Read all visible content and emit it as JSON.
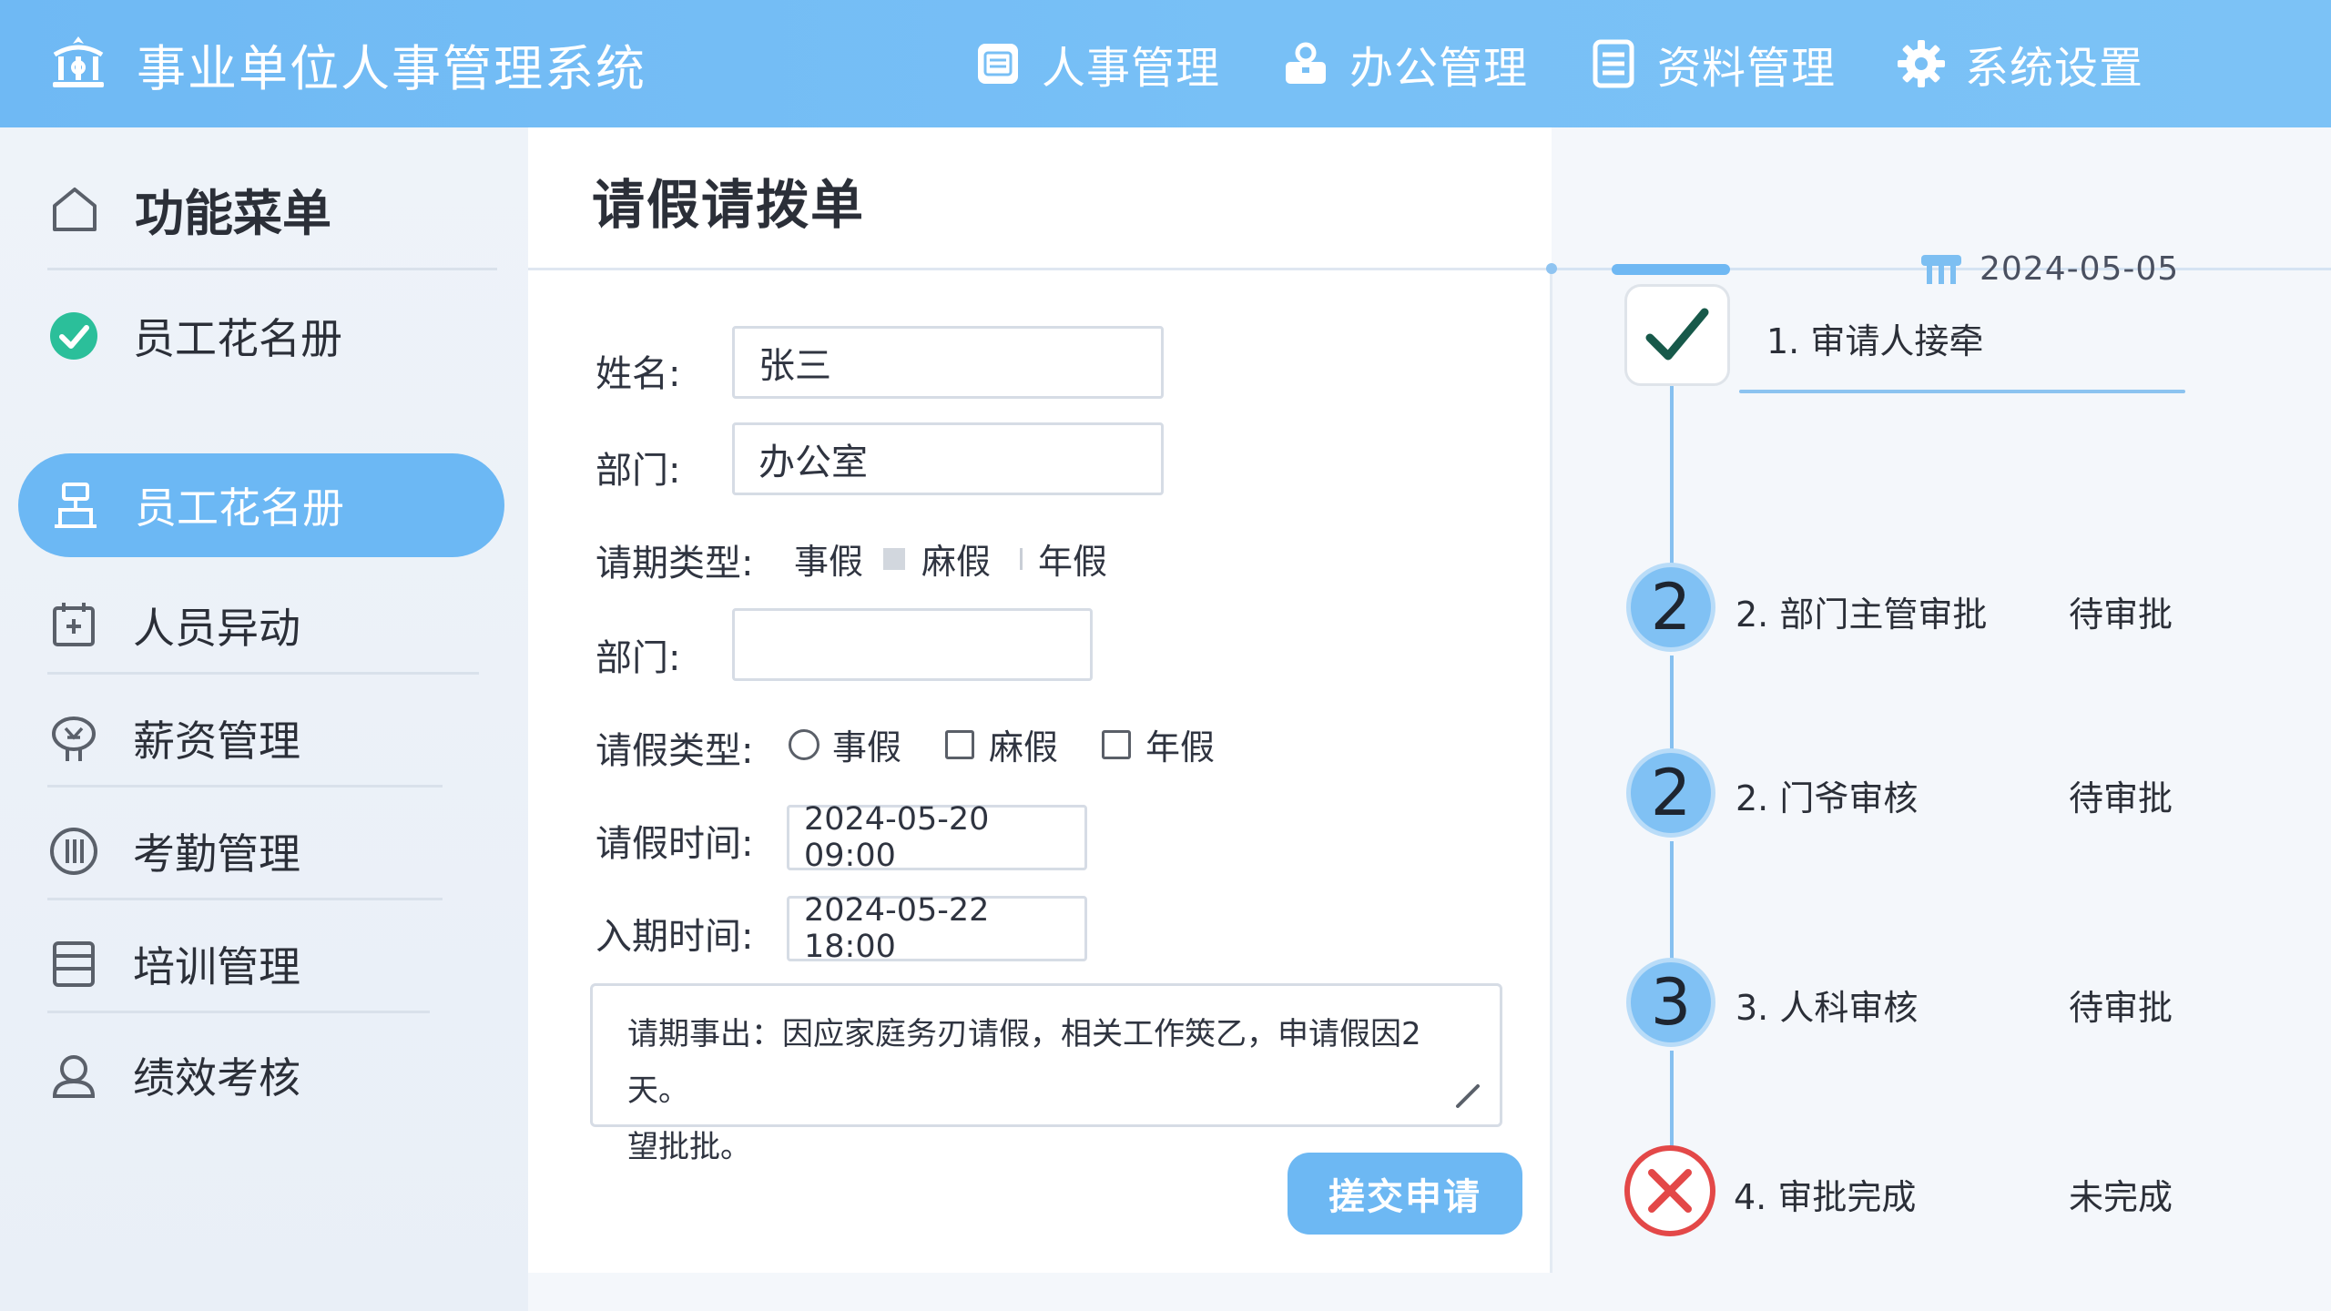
{
  "app": {
    "title": "事业单位人事管理系统"
  },
  "topnav": [
    {
      "label": "人事管理",
      "icon": "id-card-icon"
    },
    {
      "label": "办公管理",
      "icon": "briefcase-icon"
    },
    {
      "label": "资料管理",
      "icon": "document-icon"
    },
    {
      "label": "系统设置",
      "icon": "gear-icon"
    }
  ],
  "sidebar": {
    "header": "功能菜单",
    "items": [
      {
        "label": "员工花名册",
        "icon": "check-circle-icon"
      },
      {
        "label": "员工花名册",
        "icon": "org-chart-icon",
        "active": true
      },
      {
        "label": "人员异动",
        "icon": "calendar-icon"
      },
      {
        "label": "薪资管理",
        "icon": "money-icon"
      },
      {
        "label": "考勤管理",
        "icon": "clock-icon"
      },
      {
        "label": "培训管理",
        "icon": "book-icon"
      },
      {
        "label": "绩效考核",
        "icon": "user-icon"
      }
    ]
  },
  "form": {
    "title": "请假请拨单",
    "name_label": "姓名:",
    "name_value": "张三",
    "dept_label": "部门:",
    "dept_value": "办公室",
    "period_type_label": "请期类型:",
    "period_type_options": [
      "事假",
      "麻假",
      "年假"
    ],
    "dept2_label": "部门:",
    "dept2_value": "",
    "leave_type_label": "请假类型:",
    "leave_type_options": [
      "事假",
      "麻假",
      "年假"
    ],
    "start_label": "请假时间:",
    "start_value": "2024-05-20 09:00",
    "end_label": "入期时间:",
    "end_value": "2024-05-22 18:00",
    "reason_line1": "请期事出：因应家庭务刃请假，相关工作筴乙，申请假因2天。",
    "reason_line2": "望批批。",
    "submit_label": "搓交申请"
  },
  "workflow": {
    "date": "2024-05-05",
    "steps": [
      {
        "badge": "",
        "label": "1. 审请人接牵",
        "status": ""
      },
      {
        "badge": "2",
        "label": "2. 部门主管审批",
        "status": "待审批"
      },
      {
        "badge": "2",
        "label": "2. 门爷审核",
        "status": "待审批"
      },
      {
        "badge": "3",
        "label": "3. 人科审核",
        "status": "待审批"
      },
      {
        "badge": "",
        "label": "4. 审批完成",
        "status": "未完成"
      }
    ]
  },
  "colors": {
    "topbar": "#6fb9f4",
    "accent": "#6cb8f4",
    "check_green": "#2bbf9a",
    "reject_red": "#e34848"
  }
}
